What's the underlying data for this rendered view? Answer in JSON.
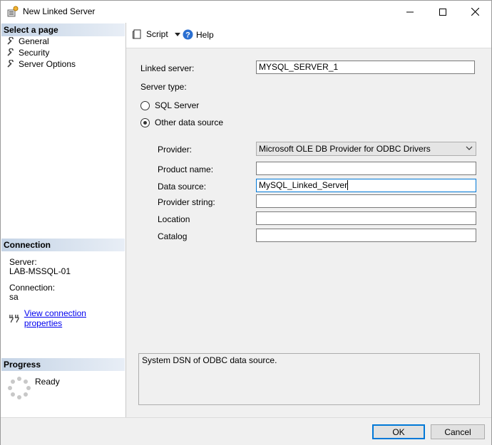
{
  "window": {
    "title": "New Linked Server"
  },
  "left": {
    "select_page_header": "Select a page",
    "pages": [
      {
        "label": "General"
      },
      {
        "label": "Security"
      },
      {
        "label": "Server Options"
      }
    ],
    "connection_header": "Connection",
    "server_label": "Server:",
    "server_value": "LAB-MSSQL-01",
    "connection_label": "Connection:",
    "connection_value": "sa",
    "view_props_link": "View connection properties",
    "progress_header": "Progress",
    "progress_status": "Ready"
  },
  "toolbar": {
    "script_label": "Script",
    "help_label": "Help"
  },
  "form": {
    "linked_server_label": "Linked server:",
    "linked_server_value": "MYSQL_SERVER_1",
    "server_type_label": "Server type:",
    "sql_server_label": "SQL Server",
    "other_source_label": "Other data source",
    "selected_server_type": "Other data source",
    "provider_label": "Provider:",
    "provider_value": "Microsoft OLE DB Provider for ODBC Drivers",
    "product_name_label": "Product name:",
    "product_name_value": "",
    "data_source_label": "Data source:",
    "data_source_value": "MySQL_Linked_Server",
    "provider_string_label": "Provider string:",
    "provider_string_value": "",
    "location_label": "Location",
    "location_value": "",
    "catalog_label": "Catalog",
    "catalog_value": "",
    "description": "System DSN of ODBC data source."
  },
  "footer": {
    "ok_label": "OK",
    "cancel_label": "Cancel"
  },
  "colors": {
    "accent": "#0078d7",
    "link": "#0000ee",
    "header_gradient_start": "#c5d4e6"
  }
}
